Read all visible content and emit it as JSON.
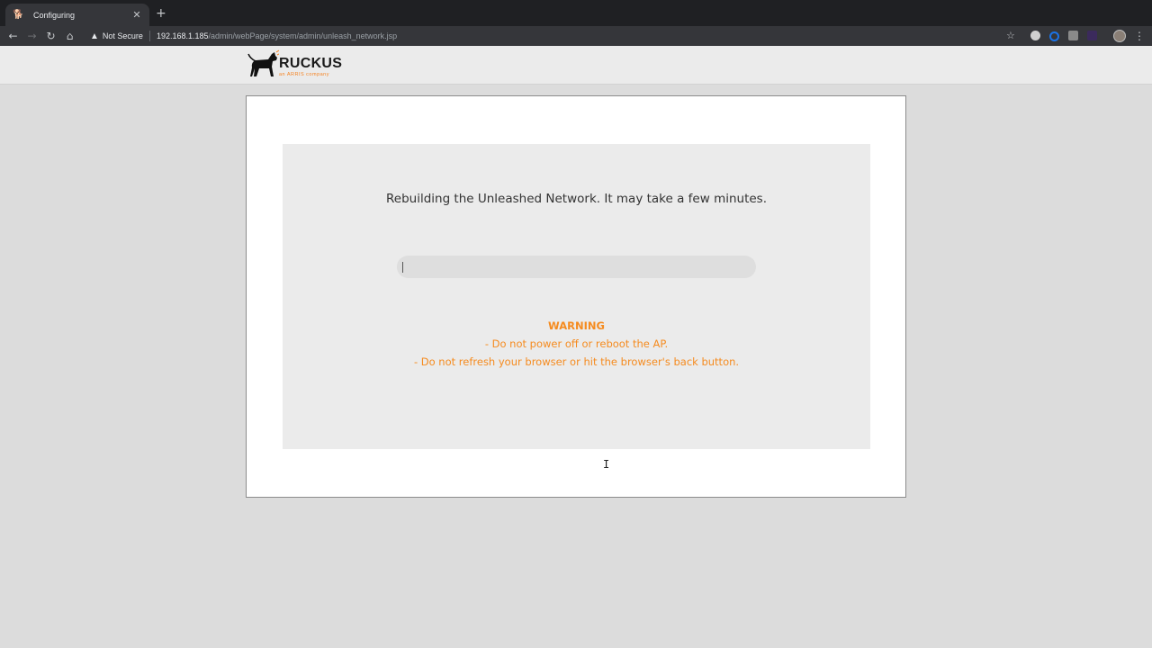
{
  "browser": {
    "tab": {
      "title": "Configuring"
    },
    "address": {
      "security_label": "Not Secure",
      "url_host": "192.168.1.185",
      "url_path": "/admin/webPage/system/admin/unleash_network.jsp"
    }
  },
  "header": {
    "logo_word": "RUCKUS",
    "logo_tagline": "an ARRIS company"
  },
  "main": {
    "message": "Rebuilding the Unleashed Network. It may take a few minutes.",
    "progress": {
      "percent": 1
    },
    "warning": {
      "title": "WARNING",
      "lines": [
        "- Do not power off or reboot the AP.",
        "- Do not refresh your browser or hit the browser's back button."
      ]
    }
  },
  "colors": {
    "warning": "#f58b1f",
    "brand_orange": "#f58220"
  }
}
